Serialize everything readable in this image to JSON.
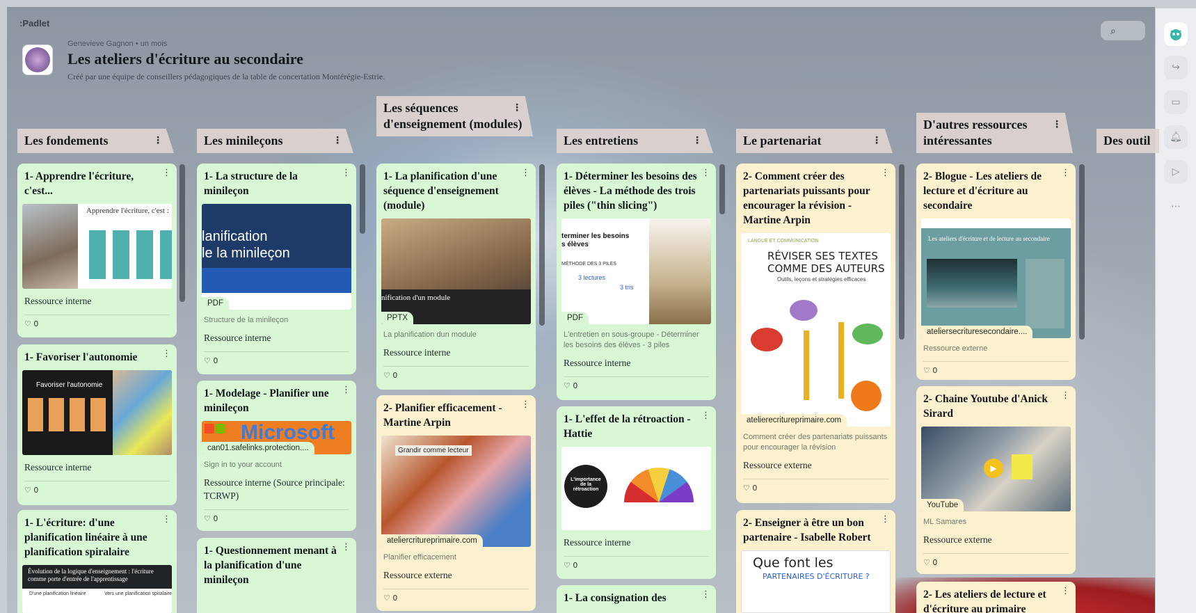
{
  "app": {
    "logo": ":Padlet"
  },
  "board": {
    "author": "Genevieve Gagnon • un mois",
    "title": "Les ateliers d'écriture au secondaire",
    "subtitle": "Créé par une équipe de conseillers pédagogiques de la table de concertation Montérégie-Estrie."
  },
  "toolbar": {
    "search_icon": "search-icon"
  },
  "rail": {
    "items": [
      "avatar-icon",
      "share-icon",
      "slideshow-icon",
      "bell-icon",
      "play-icon",
      "more-icon"
    ]
  },
  "columns": [
    {
      "title": "Les fondements"
    },
    {
      "title": "Les minileçons"
    },
    {
      "title": "Les séquences d'enseignement (modules)"
    },
    {
      "title": "Les entretiens"
    },
    {
      "title": "Le partenariat"
    },
    {
      "title": "D'autres ressources intéressantes"
    },
    {
      "title": "Des outil"
    }
  ],
  "cards": {
    "c1": {
      "title": "1- Apprendre l'écriture, c'est...",
      "thumb_text": "Apprendre l'écriture, c'est :",
      "desc": "Ressource interne",
      "likes": "0"
    },
    "c2": {
      "title": "1- Favoriser l'autonomie",
      "thumb_text": "Favoriser l'autonomie",
      "desc": "Ressource interne",
      "likes": "0"
    },
    "c3": {
      "title": "1- L'écriture: d'une planification linéaire à une planification spiralaire",
      "thumb_text": "Évolution de la logique d'enseignement : l'écriture comme porte d'entrée de l'apprentissage",
      "thumb_sub1": "D'une planification linéaire",
      "thumb_sub2": "Vers une planification spiralaire"
    },
    "c4": {
      "title": "1- La structure de la minileçon",
      "thumb_text1": "lanification",
      "thumb_text2": "le la minileçon",
      "tag": "PDF",
      "cap": "Structure de la minileçon",
      "desc": "Ressource interne",
      "likes": "0"
    },
    "c5": {
      "title": "1- Modelage - Planifier une minileçon",
      "thumb_text": "Microsoft",
      "tag": "can01.safelinks.protection....",
      "cap": "Sign in to your account",
      "desc": "Ressource interne (Source principale: TCRWP)",
      "likes": "0"
    },
    "c6": {
      "title": "1- Questionnement menant à la planification d'une minileçon"
    },
    "c7": {
      "title": "1- La planification d'une séquence d'enseignement (module)",
      "thumb_text": "nification d'un module",
      "tag": "PPTX",
      "cap": "La planification dun module",
      "desc": "Ressource interne",
      "likes": "0"
    },
    "c8": {
      "title": "2- Planifier efficacement - Martine Arpin",
      "thumb_text": "Grandir comme lecteur",
      "tag": "ateliercritureprimaire.com",
      "cap": "Planifier efficacement",
      "desc": "Ressource externe",
      "likes": "0"
    },
    "c9": {
      "title": "1- Déterminer les besoins des élèves - La méthode des trois piles (\"thin slicing\")",
      "thumb_text1": "terminer les besoins",
      "thumb_text2": "s élèves",
      "thumb_text3": "MÉTHODE DES 3 PILES",
      "thumb_text4": "3 lectures",
      "thumb_text5": "3 tris",
      "tag": "PDF",
      "cap": "L'entretien en sous-groupe - Déterminer les besoins des élèves - 3 piles",
      "desc": "Ressource interne",
      "likes": "0"
    },
    "c10": {
      "title": "1- L'effet de la rétroaction - Hattie",
      "thumb_text": "L'importance de la rétroaction",
      "desc": "Ressource interne",
      "likes": "0"
    },
    "c11": {
      "title": "1- La consignation des"
    },
    "c12": {
      "title": "2- Comment créer des partenariats puissants pour encourager la révision - Martine Arpin",
      "thumb_kicker": "LANGUE ET COMMUNICATION",
      "thumb_text1": "RÉVISER SES TEXTES",
      "thumb_text2": "COMME DES AUTEURS",
      "thumb_text3": "Outils, leçons et stratégies efficaces",
      "tag": "atelierecritureprimaire.com",
      "cap": "Comment créer des partenariats puissants pour encourager la révision",
      "desc": "Ressource externe",
      "likes": "0"
    },
    "c13": {
      "title": "2- Enseigner à être un bon partenaire - Isabelle Robert",
      "thumb_text1": "Que font les",
      "thumb_text2": "PARTENAIRES D'ÉCRITURE ?"
    },
    "c14": {
      "title": "2- Blogue - Les ateliers de lecture et d'écriture au secondaire",
      "thumb_text": "Les ateliers d'écriture et de lecture au secondaire",
      "tag": "ateliersecrituresecondaire....",
      "cap": "Ressource externe",
      "likes": "0"
    },
    "c15": {
      "title": "2- Chaine Youtube d'Anick Sirard",
      "tag": "YouTube",
      "cap": "ML Samares",
      "desc": "Ressource externe",
      "likes": "0"
    },
    "c16": {
      "title": "2- Les ateliers de lecture et d'écriture au primaire"
    }
  }
}
